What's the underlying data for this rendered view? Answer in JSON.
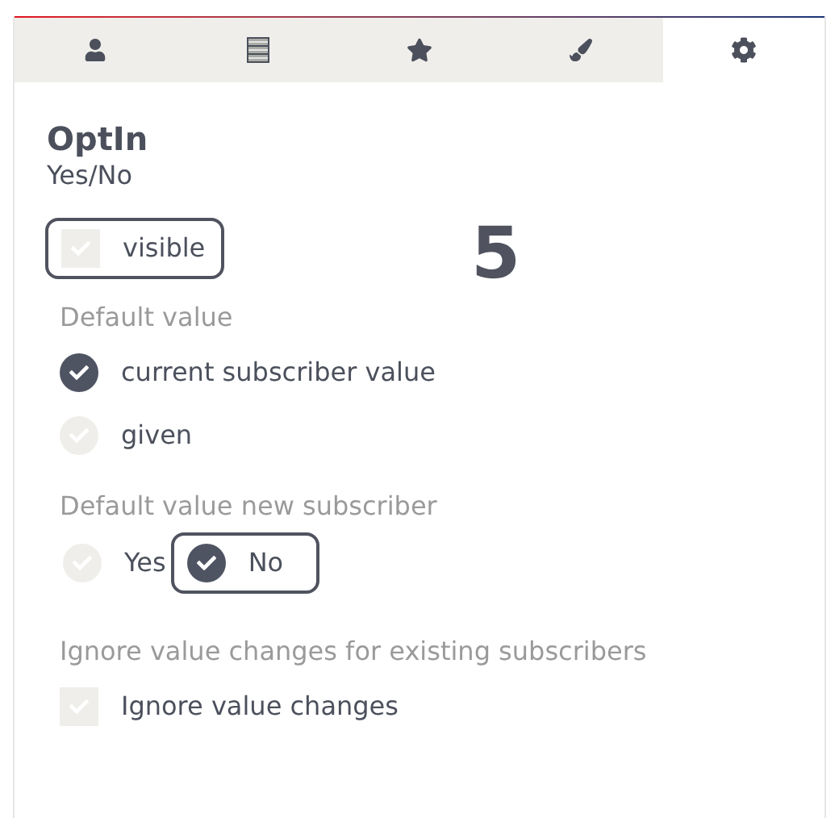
{
  "tabs": [
    {
      "kind": "user",
      "selected": false
    },
    {
      "kind": "cabinet",
      "selected": false
    },
    {
      "kind": "star",
      "selected": false
    },
    {
      "kind": "brush",
      "selected": false
    },
    {
      "kind": "gear",
      "selected": true
    }
  ],
  "field": {
    "title": "OptIn",
    "type": "Yes/No"
  },
  "step_marker": "5",
  "visible": {
    "label": "visible",
    "checked": false,
    "focused": true
  },
  "default_value": {
    "heading": "Default value",
    "options": [
      {
        "label": "current subscriber value",
        "selected": true
      },
      {
        "label": "given",
        "selected": false
      }
    ]
  },
  "new_subscriber": {
    "heading": "Default value new subscriber",
    "options": [
      {
        "label": "Yes",
        "selected": false,
        "focused": false
      },
      {
        "label": "No",
        "selected": true,
        "focused": true
      }
    ]
  },
  "ignore": {
    "heading": "Ignore value changes for existing subscribers",
    "label": "Ignore value changes",
    "checked": false
  }
}
